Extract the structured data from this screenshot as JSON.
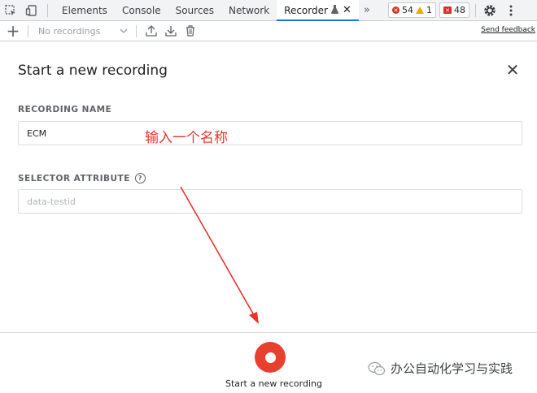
{
  "devtools": {
    "tabs": [
      {
        "label": "Elements"
      },
      {
        "label": "Console"
      },
      {
        "label": "Sources"
      },
      {
        "label": "Network"
      },
      {
        "label": "Recorder",
        "active": true
      }
    ],
    "close_glyph": "✕",
    "more_glyph": "»",
    "badges": {
      "errors": "54",
      "warnings": "1",
      "issues": "48"
    },
    "colors": {
      "error": "#d93025",
      "warning": "#f2a600",
      "active_tab": "#1a73e8"
    }
  },
  "toolbar": {
    "add_glyph": "+",
    "recording_select_placeholder": "No recordings",
    "send_feedback_label": "Send feedback"
  },
  "panel": {
    "title": "Start a new recording",
    "close_glyph": "✕",
    "recording_name": {
      "label": "RECORDING NAME",
      "value": "ECM"
    },
    "selector_attribute": {
      "label": "SELECTOR ATTRIBUTE",
      "help_glyph": "?",
      "placeholder": "data-testid"
    },
    "annotation_text": "输入一个名称",
    "annotation_color": "#e8352a"
  },
  "footer": {
    "start_recording_label": "Start a new recording",
    "record_button_color": "#e8402f"
  },
  "watermark": {
    "text": "办公自动化学习与实践"
  }
}
